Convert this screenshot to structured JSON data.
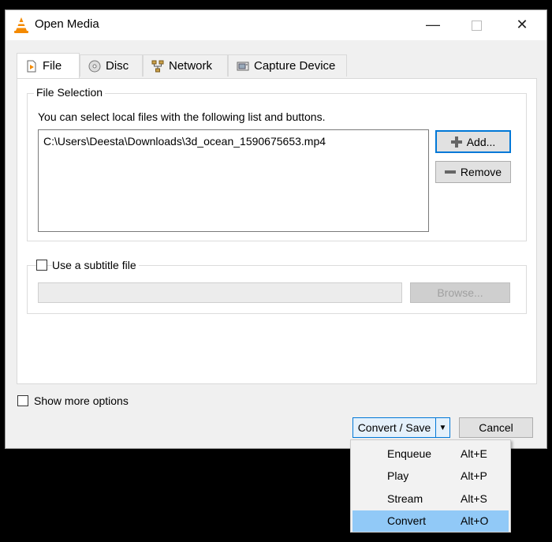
{
  "window": {
    "title": "Open Media",
    "close_glyph": "✕",
    "minimize_glyph": "—"
  },
  "tabs": [
    {
      "label": "File",
      "icon": "file-play-icon"
    },
    {
      "label": "Disc",
      "icon": "disc-icon"
    },
    {
      "label": "Network",
      "icon": "network-icon"
    },
    {
      "label": "Capture Device",
      "icon": "capture-device-icon"
    }
  ],
  "file_selection": {
    "group_label": "File Selection",
    "description": "You can select local files with the following list and buttons.",
    "files": [
      "C:\\Users\\Deesta\\Downloads\\3d_ocean_1590675653.mp4"
    ],
    "add_label": "Add...",
    "remove_label": "Remove"
  },
  "subtitle": {
    "checkbox_label": "Use a subtitle file",
    "checked": false,
    "path_value": "",
    "browse_label": "Browse..."
  },
  "options": {
    "show_more_label": "Show more options",
    "checked": false
  },
  "actions": {
    "convert_save_label": "Convert / Save",
    "cancel_label": "Cancel"
  },
  "dropdown_menu": [
    {
      "label": "Enqueue",
      "shortcut": "Alt+E",
      "highlighted": false
    },
    {
      "label": "Play",
      "shortcut": "Alt+P",
      "highlighted": false
    },
    {
      "label": "Stream",
      "shortcut": "Alt+S",
      "highlighted": false
    },
    {
      "label": "Convert",
      "shortcut": "Alt+O",
      "highlighted": true
    }
  ],
  "colors": {
    "accent": "#0078d7",
    "menu_highlight": "#91c9f7",
    "vlc_orange": "#f48a00"
  }
}
